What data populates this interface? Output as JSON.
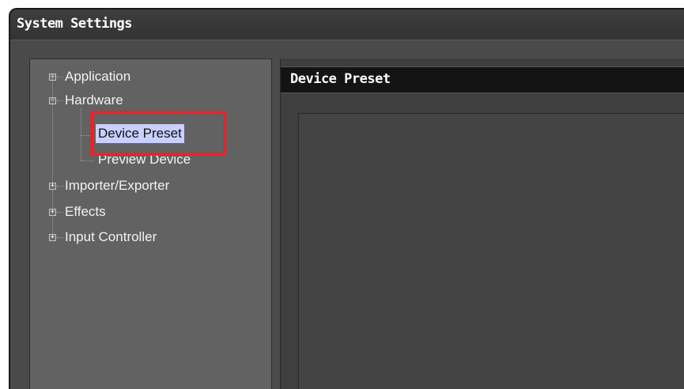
{
  "window": {
    "title": "System Settings"
  },
  "tree": {
    "application": "Application",
    "hardware": "Hardware",
    "device_preset": "Device Preset",
    "preview_device": "Preview Device",
    "importer_exporter": "Importer/Exporter",
    "effects": "Effects",
    "input_controller": "Input Controller",
    "collapsed_symbol": "+",
    "expanded_symbol": "−"
  },
  "content": {
    "title": "Device Preset"
  },
  "colors": {
    "selection": "#c9d0ff",
    "highlight": "#e8232c",
    "background": "#4a4a4a"
  }
}
